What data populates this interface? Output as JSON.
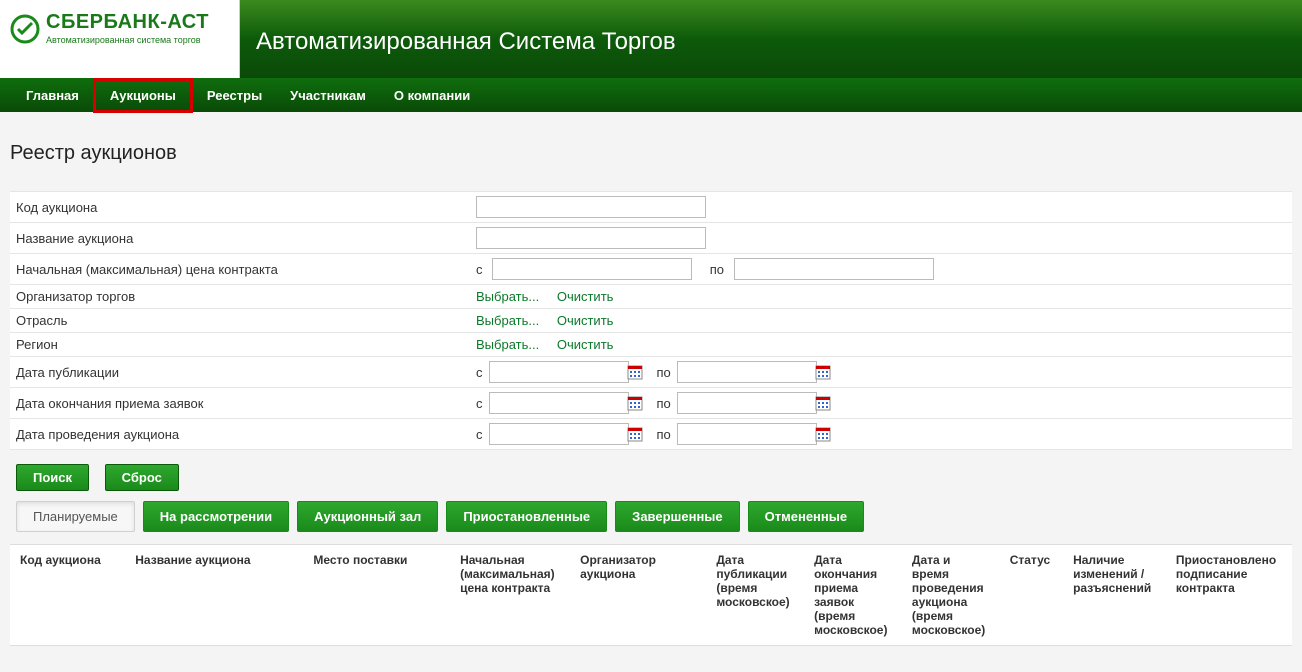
{
  "logo": {
    "brand": "СБЕРБАНК-АСТ",
    "tagline": "Автоматизированная система торгов"
  },
  "header_title": "Автоматизированная Система Торгов",
  "nav": [
    "Главная",
    "Аукционы",
    "Реестры",
    "Участникам",
    "О компании"
  ],
  "nav_highlight_index": 1,
  "page_title": "Реестр аукционов",
  "filters": {
    "auction_code": {
      "label": "Код аукциона",
      "value": ""
    },
    "auction_name": {
      "label": "Название аукциона",
      "value": ""
    },
    "price": {
      "label": "Начальная (максимальная) цена контракта",
      "from_label": "с",
      "to_label": "по",
      "from": "",
      "to": ""
    },
    "organizer": {
      "label": "Организатор торгов",
      "choose": "Выбрать...",
      "clear": "Очистить"
    },
    "industry": {
      "label": "Отрасль",
      "choose": "Выбрать...",
      "clear": "Очистить"
    },
    "region": {
      "label": "Регион",
      "choose": "Выбрать...",
      "clear": "Очистить"
    },
    "pub_date": {
      "label": "Дата публикации",
      "from_label": "с",
      "to_label": "по",
      "from": "",
      "to": ""
    },
    "end_date": {
      "label": "Дата окончания приема заявок",
      "from_label": "с",
      "to_label": "по",
      "from": "",
      "to": ""
    },
    "auc_date": {
      "label": "Дата проведения аукциона",
      "from_label": "с",
      "to_label": "по",
      "from": "",
      "to": ""
    }
  },
  "buttons": {
    "search": "Поиск",
    "reset": "Сброс"
  },
  "tabs": [
    "Планируемые",
    "На рассмотрении",
    "Аукционный зал",
    "Приостановленные",
    "Завершенные",
    "Отмененные"
  ],
  "active_tab_index": 0,
  "columns": [
    "Код аукциона",
    "Название аукциона",
    "Место поставки",
    "Начальная (максимальная) цена контракта",
    "Организатор аукциона",
    "Дата публикации (время московское)",
    "Дата окончания приема заявок (время московское)",
    "Дата и время проведения аукциона (время московское)",
    "Статус",
    "Наличие изменений / разъяснений",
    "Приостановлено подписание контракта"
  ]
}
